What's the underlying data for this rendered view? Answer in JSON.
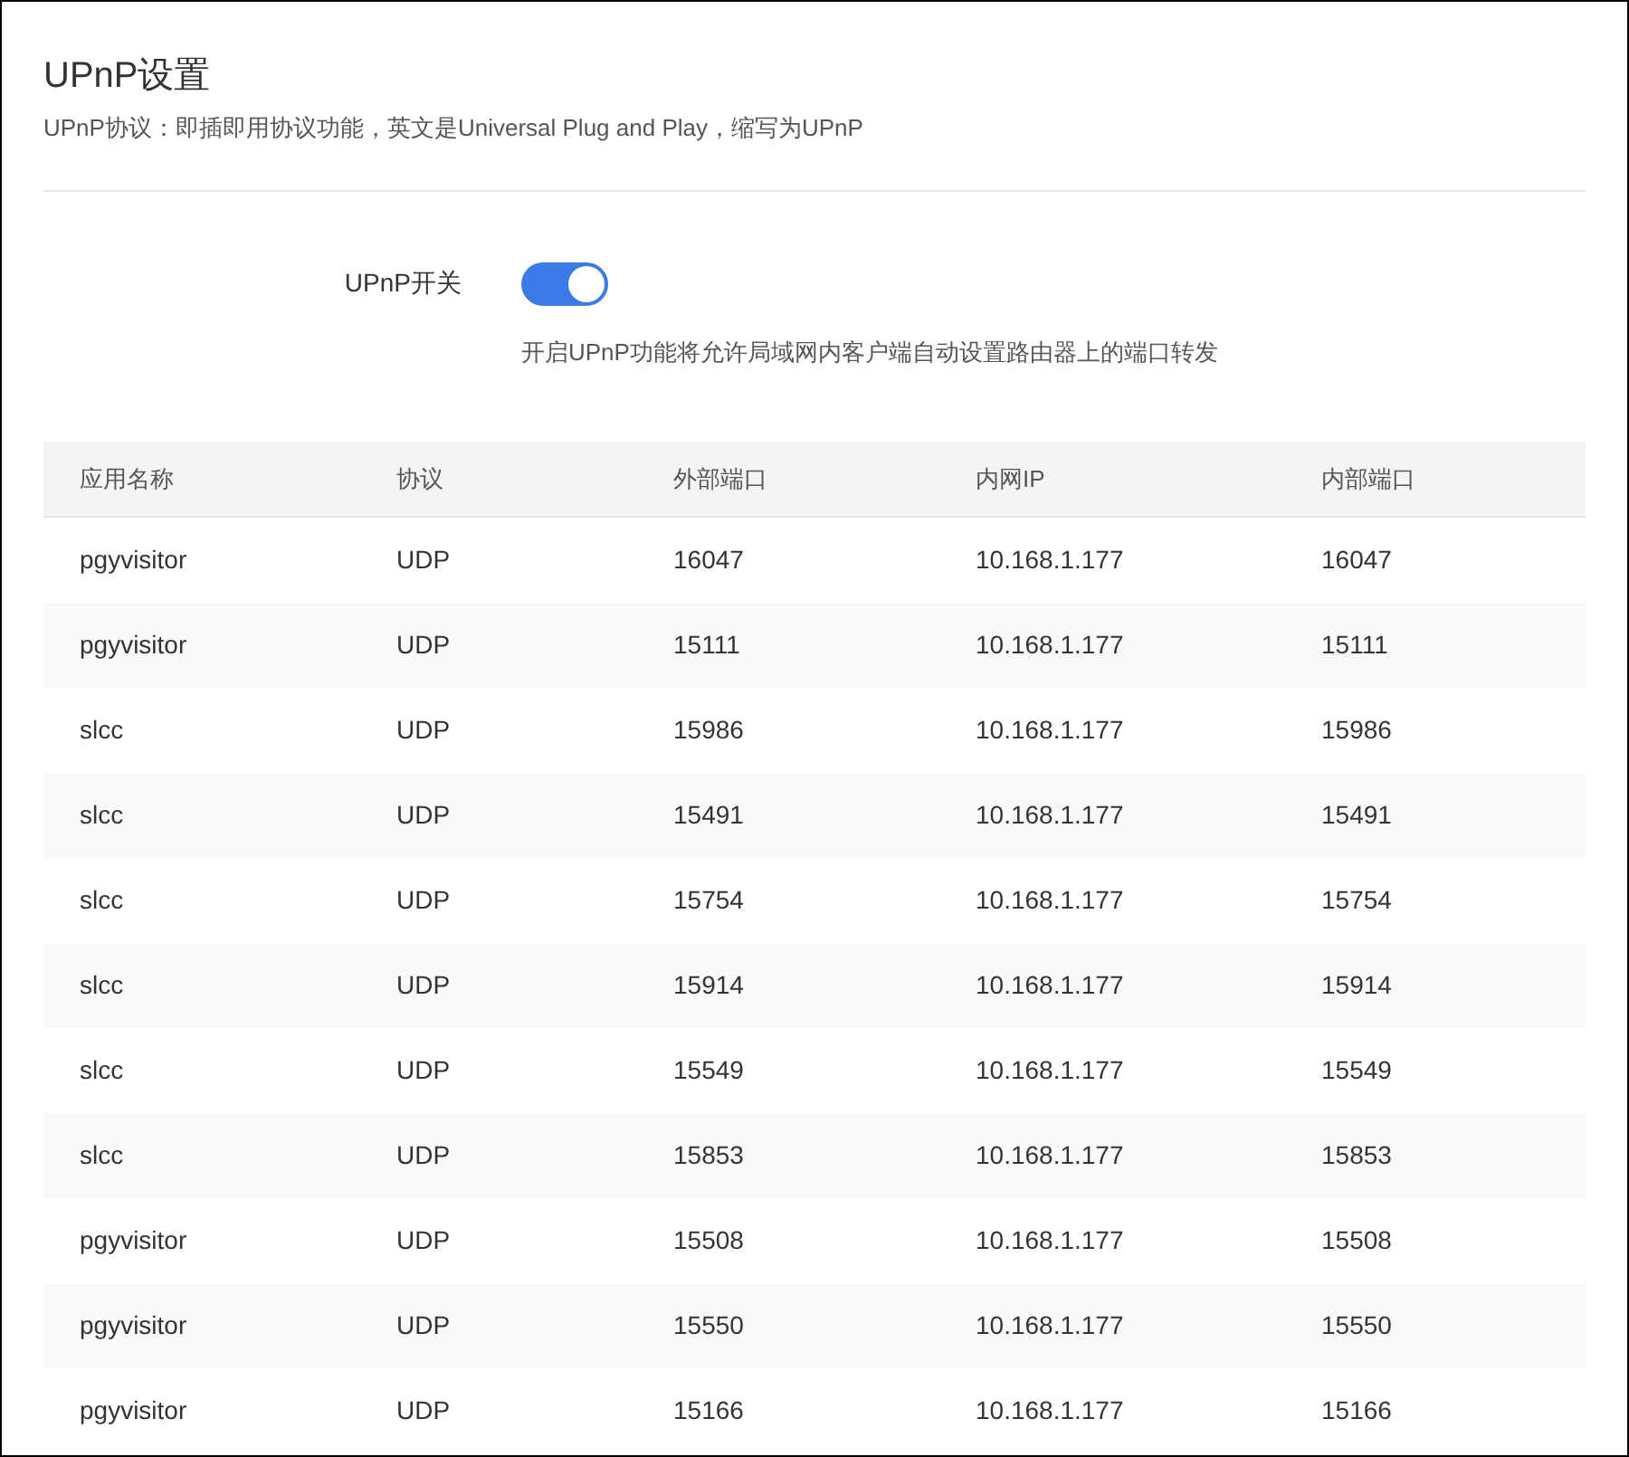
{
  "title": "UPnP设置",
  "description": "UPnP协议：即插即用协议功能，英文是Universal Plug and Play，缩写为UPnP",
  "switch": {
    "label": "UPnP开关",
    "on": true,
    "hint": "开启UPnP功能将允许局域网内客户端自动设置路由器上的端口转发"
  },
  "table": {
    "columns": [
      "应用名称",
      "协议",
      "外部端口",
      "内网IP",
      "内部端口"
    ],
    "rows": [
      [
        "pgyvisitor",
        "UDP",
        "16047",
        "10.168.1.177",
        "16047"
      ],
      [
        "pgyvisitor",
        "UDP",
        "15111",
        "10.168.1.177",
        "15111"
      ],
      [
        "slcc",
        "UDP",
        "15986",
        "10.168.1.177",
        "15986"
      ],
      [
        "slcc",
        "UDP",
        "15491",
        "10.168.1.177",
        "15491"
      ],
      [
        "slcc",
        "UDP",
        "15754",
        "10.168.1.177",
        "15754"
      ],
      [
        "slcc",
        "UDP",
        "15914",
        "10.168.1.177",
        "15914"
      ],
      [
        "slcc",
        "UDP",
        "15549",
        "10.168.1.177",
        "15549"
      ],
      [
        "slcc",
        "UDP",
        "15853",
        "10.168.1.177",
        "15853"
      ],
      [
        "pgyvisitor",
        "UDP",
        "15508",
        "10.168.1.177",
        "15508"
      ],
      [
        "pgyvisitor",
        "UDP",
        "15550",
        "10.168.1.177",
        "15550"
      ],
      [
        "pgyvisitor",
        "UDP",
        "15166",
        "10.168.1.177",
        "15166"
      ]
    ]
  }
}
